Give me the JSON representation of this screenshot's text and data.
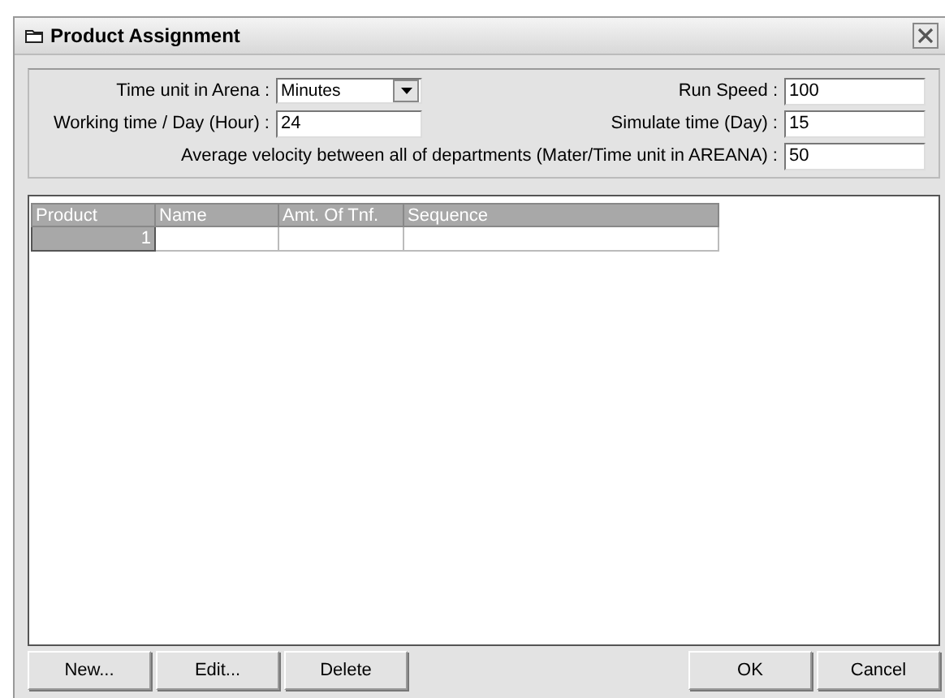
{
  "window": {
    "title": "Product Assignment"
  },
  "settings": {
    "time_unit": {
      "label": "Time unit in Arena :",
      "value": "Minutes"
    },
    "working_time": {
      "label": "Working time / Day (Hour) :",
      "value": "24"
    },
    "run_speed": {
      "label": "Run Speed :",
      "value": "100"
    },
    "simulate_time": {
      "label": "Simulate time (Day) :",
      "value": "15"
    },
    "velocity": {
      "label": "Average velocity between all of departments (Mater/Time unit in AREANA) :",
      "value": "50"
    }
  },
  "table": {
    "columns": [
      "Product",
      "Name",
      "Amt. Of Tnf.",
      "Sequence"
    ],
    "rows": [
      [
        "1",
        "",
        "",
        ""
      ]
    ]
  },
  "buttons_left": [
    "New...",
    "Edit...",
    "Delete"
  ],
  "buttons_right": [
    "OK",
    "Cancel"
  ]
}
